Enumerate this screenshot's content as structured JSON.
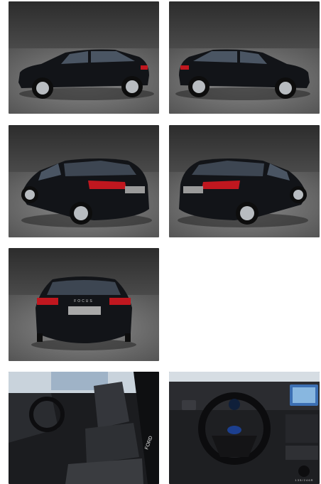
{
  "gallery": {
    "photos": [
      {
        "view": "side-left"
      },
      {
        "view": "side-right"
      },
      {
        "view": "rear-left-three-quarter"
      },
      {
        "view": "rear-right-three-quarter"
      },
      {
        "view": "rear"
      },
      {
        "view": "interior-front-seats"
      },
      {
        "view": "interior-dashboard"
      }
    ],
    "badge_text": "FOCUS",
    "shifter_text": "1 3 5 / 2 4 6 R",
    "sill_text": "FORD"
  },
  "colors": {
    "car_body": "#121418",
    "studio_wall": "#3a3a3a",
    "studio_floor": "#6b6b6b",
    "tail_light": "#c0171f",
    "ford_logo": "#1c3f8f"
  }
}
